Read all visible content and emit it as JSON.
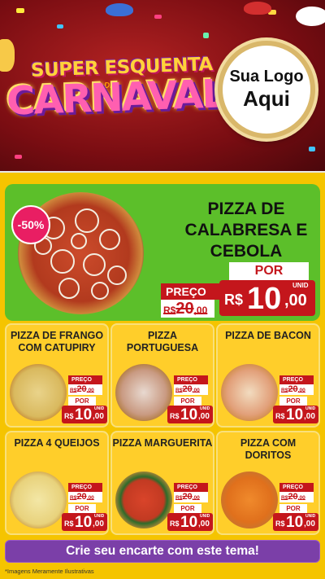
{
  "header": {
    "title_top": "SUPER ESQUENTA",
    "title_de": "DE",
    "title_main": "CARNAVAL",
    "logo_line1": "Sua Logo",
    "logo_line2": "Aqui"
  },
  "hero": {
    "discount": "-50%",
    "name": "PIZZA DE CALABRESA E CEBOLA",
    "preco_label": "PREÇO",
    "old_currency": "R$",
    "old_price": "20",
    "old_cents": ",00",
    "por_label": "POR",
    "unit_label": "UNID",
    "new_currency": "R$",
    "new_price": "10",
    "new_cents": ",00"
  },
  "products": [
    {
      "name": "PIZZA DE FRANGO COM CATUPIRY",
      "preco_label": "PREÇO",
      "old_currency": "R$",
      "old_price": "20",
      "old_cents": ",00",
      "por_label": "POR",
      "unit_label": "UNID",
      "new_currency": "R$",
      "new_price": "10",
      "new_cents": ",00"
    },
    {
      "name": "PIZZA PORTUGUESA",
      "preco_label": "PREÇO",
      "old_currency": "R$",
      "old_price": "20",
      "old_cents": ",00",
      "por_label": "POR",
      "unit_label": "UNID",
      "new_currency": "R$",
      "new_price": "10",
      "new_cents": ",00"
    },
    {
      "name": "PIZZA DE BACON",
      "preco_label": "PREÇO",
      "old_currency": "R$",
      "old_price": "20",
      "old_cents": ",00",
      "por_label": "POR",
      "unit_label": "UNID",
      "new_currency": "R$",
      "new_price": "10",
      "new_cents": ",00"
    },
    {
      "name": "PIZZA 4 QUEIJOS",
      "preco_label": "PREÇO",
      "old_currency": "R$",
      "old_price": "20",
      "old_cents": ",00",
      "por_label": "POR",
      "unit_label": "UNID",
      "new_currency": "R$",
      "new_price": "10",
      "new_cents": ",00"
    },
    {
      "name": "PIZZA MARGUERITA",
      "preco_label": "PREÇO",
      "old_currency": "R$",
      "old_price": "20",
      "old_cents": ",00",
      "por_label": "POR",
      "unit_label": "UNID",
      "new_currency": "R$",
      "new_price": "10",
      "new_cents": ",00"
    },
    {
      "name": "PIZZA COM DORITOS",
      "preco_label": "PREÇO",
      "old_currency": "R$",
      "old_price": "20",
      "old_cents": ",00",
      "por_label": "POR",
      "unit_label": "UNID",
      "new_currency": "R$",
      "new_price": "10",
      "new_cents": ",00"
    }
  ],
  "footer": {
    "cta": "Crie seu encarte com este tema!",
    "disclaimer": "*Imagens Meramente Ilustrativas"
  },
  "colors": {
    "header_bg": "#7a0d12",
    "body_bg": "#f5c400",
    "hero_bg": "#5cbf2a",
    "price_red": "#c4161c",
    "cta_purple": "#7b3fa8"
  }
}
